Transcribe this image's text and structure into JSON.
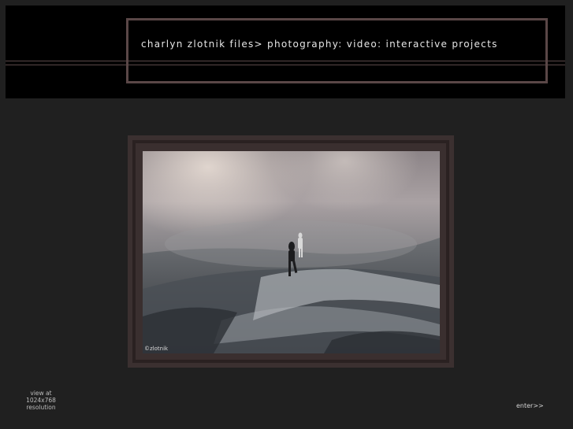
{
  "header": {
    "title": "charlyn zlotnik files> photography: video: interactive projects"
  },
  "photo": {
    "description_icon": "photo-desert-dust-runners",
    "credit": "©zlotnik"
  },
  "footer": {
    "view_line1": "view at",
    "view_line2": "1024x768",
    "view_line3": "resolution",
    "enter_label": "enter>>"
  },
  "colors": {
    "background": "#202020",
    "header_bg": "#000000",
    "frame_accent": "#5a4747",
    "text": "#e6e6e6"
  }
}
